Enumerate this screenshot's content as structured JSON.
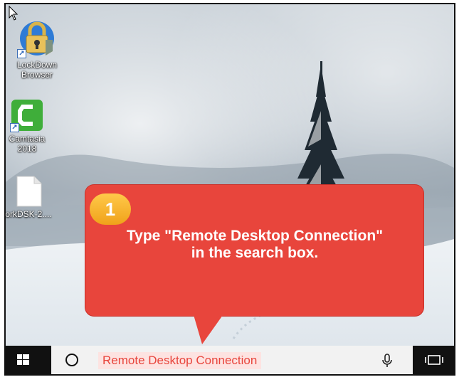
{
  "desktop": {
    "icons": [
      {
        "label_line1": "LockDown",
        "label_line2": "Browser",
        "icon": "lockdown-browser-icon"
      },
      {
        "label_line1": "Camtasia",
        "label_line2": "2018",
        "icon": "camtasia-icon"
      },
      {
        "label_line1": "orkDSK-2....",
        "label_line2": "",
        "icon": "document-icon"
      }
    ]
  },
  "callout": {
    "step_number": "1",
    "text": "Type \"Remote Desktop Connection\" in the search box.",
    "color": "#e8453c",
    "badge_color": "#f5a623"
  },
  "taskbar": {
    "search_text": "Remote Desktop Connection",
    "start_icon": "windows-start-icon",
    "cortana_icon": "cortana-circle-icon",
    "mic_icon": "microphone-icon",
    "task_view_icon": "task-view-icon"
  }
}
